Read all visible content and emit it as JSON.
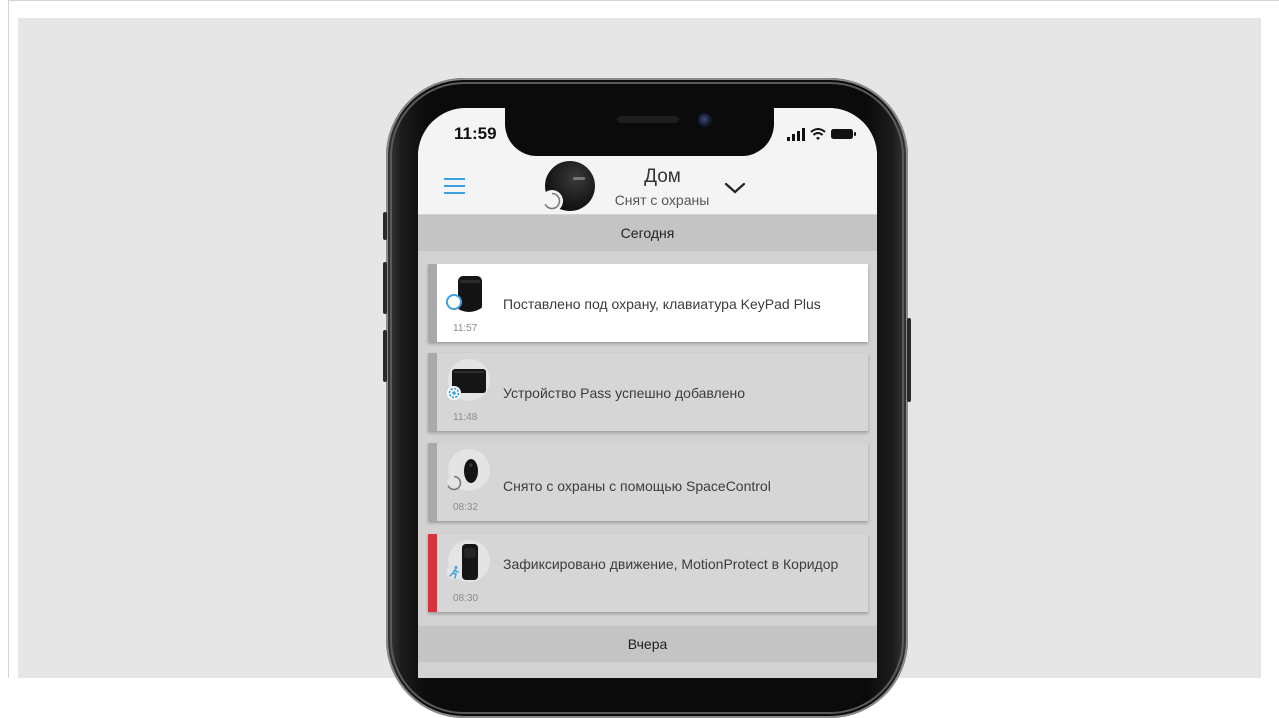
{
  "status_bar": {
    "time": "11:59",
    "icons": [
      "signal-icon",
      "wifi-icon",
      "battery-icon"
    ]
  },
  "header": {
    "hub_name": "Дом",
    "hub_state": "Снят с охраны",
    "icons": [
      "menu-icon",
      "hub-icon",
      "disarmed-status-icon",
      "chevron-down-icon"
    ]
  },
  "sections": {
    "today": "Сегодня",
    "yesterday": "Вчера"
  },
  "events": [
    {
      "time": "11:57",
      "message": "Поставлено под охрану, клавиатура KeyPad Plus",
      "device_icon": "keypad-plus-icon",
      "badge_icon": "armed-icon"
    },
    {
      "time": "11:48",
      "message": "Устройство Pass успешно добавлено",
      "device_icon": "pass-card-icon",
      "badge_icon": "settings-icon"
    },
    {
      "time": "08:32",
      "message": "Снято с охраны с помощью SpaceControl",
      "device_icon": "spacecontrol-icon",
      "badge_icon": "disarmed-icon"
    },
    {
      "time": "08:30",
      "message": "Зафиксировано движение, MotionProtect в Коридор",
      "device_icon": "motionprotect-icon",
      "badge_icon": "motion-icon"
    }
  ],
  "colors": {
    "accent": "#3aa0de",
    "alarm": "#d8333c",
    "normal_bar": "#a9a9a9",
    "highlight_card": "#ffffff",
    "card": "#d6d6d6",
    "section_header": "#c4c4c4"
  }
}
